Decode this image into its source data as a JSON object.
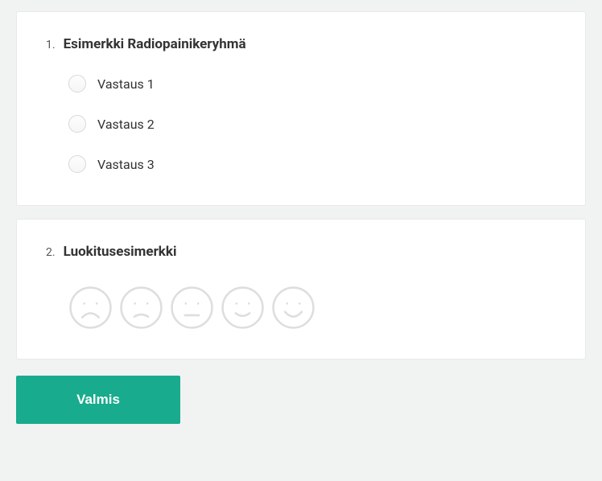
{
  "q1": {
    "number": "1.",
    "title": "Esimerkki Radiopainikeryhmä",
    "options": [
      "Vastaus 1",
      "Vastaus 2",
      "Vastaus 3"
    ]
  },
  "q2": {
    "number": "2.",
    "title": "Luokitusesimerkki"
  },
  "submit_label": "Valmis"
}
